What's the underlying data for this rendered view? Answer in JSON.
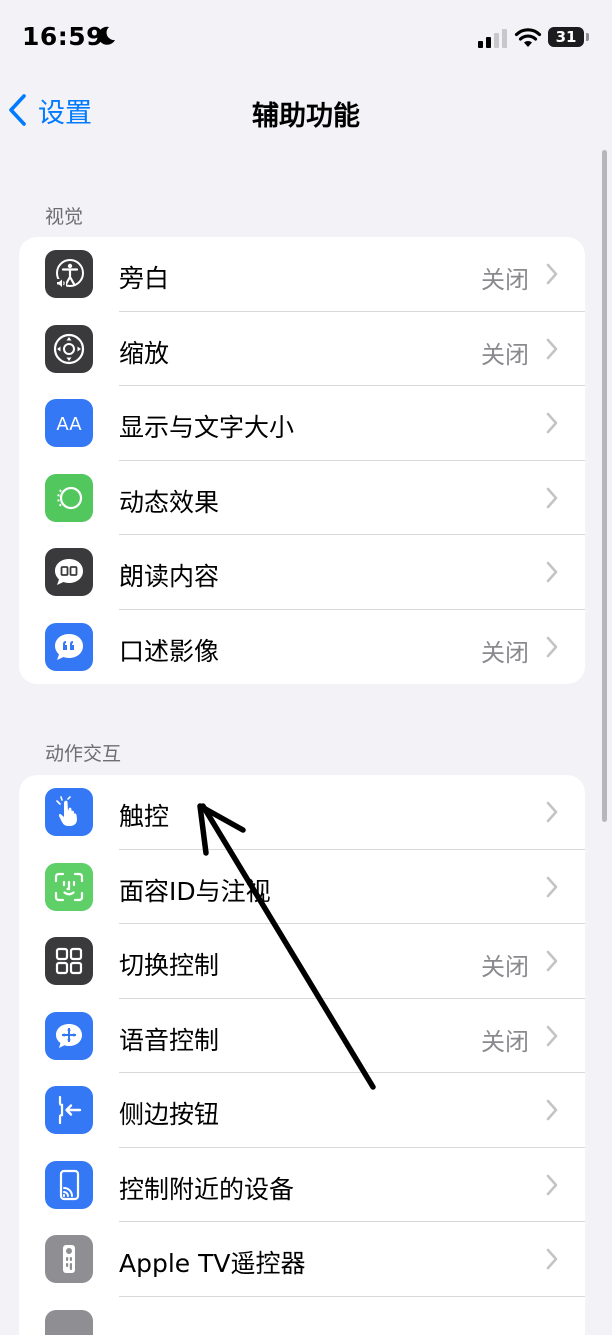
{
  "status_bar": {
    "time": "16:59",
    "battery": "31"
  },
  "nav": {
    "back_label": "设置",
    "title": "辅助功能"
  },
  "sections": [
    {
      "header": "视觉",
      "rows": [
        {
          "label": "旁白",
          "value": "关闭",
          "icon": "voiceover-icon",
          "color": "#3a3a3c"
        },
        {
          "label": "缩放",
          "value": "关闭",
          "icon": "zoom-icon",
          "color": "#3a3a3c"
        },
        {
          "label": "显示与文字大小",
          "value": "",
          "icon": "text-size-icon",
          "color": "#3478f6"
        },
        {
          "label": "动态效果",
          "value": "",
          "icon": "motion-icon",
          "color": "#52c75d"
        },
        {
          "label": "朗读内容",
          "value": "",
          "icon": "spoken-content-icon",
          "color": "#3a3a3c"
        },
        {
          "label": "口述影像",
          "value": "关闭",
          "icon": "audio-description-icon",
          "color": "#3478f6"
        }
      ]
    },
    {
      "header": "动作交互",
      "rows": [
        {
          "label": "触控",
          "value": "",
          "icon": "touch-hand-icon",
          "color": "#3478f6"
        },
        {
          "label": "面容ID与注视",
          "value": "",
          "icon": "face-id-icon",
          "color": "#5fd068"
        },
        {
          "label": "切换控制",
          "value": "关闭",
          "icon": "switch-control-icon",
          "color": "#3a3a3c"
        },
        {
          "label": "语音控制",
          "value": "关闭",
          "icon": "voice-control-icon",
          "color": "#3478f6"
        },
        {
          "label": "侧边按钮",
          "value": "",
          "icon": "side-button-icon",
          "color": "#3478f6"
        },
        {
          "label": "控制附近的设备",
          "value": "",
          "icon": "nearby-devices-icon",
          "color": "#3478f6"
        },
        {
          "label": "Apple TV遥控器",
          "value": "",
          "icon": "tv-remote-icon",
          "color": "#8e8e93"
        },
        {
          "label": "",
          "value": "",
          "icon": "keyboard-icon",
          "color": "#8e8e93"
        }
      ]
    }
  ]
}
